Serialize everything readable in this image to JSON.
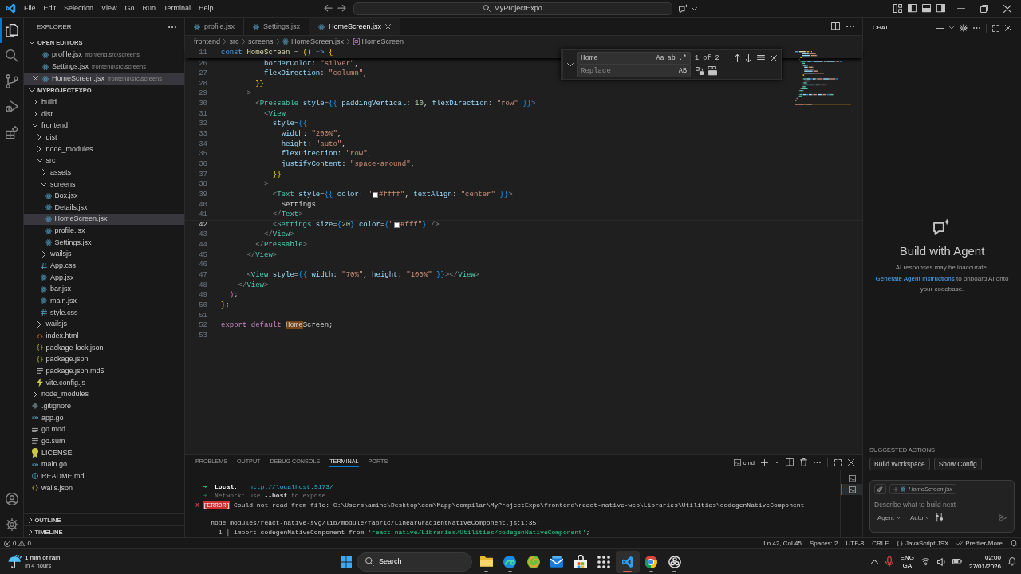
{
  "titlebar": {
    "menus": [
      "File",
      "Edit",
      "Selection",
      "View",
      "Go",
      "Run",
      "Terminal",
      "Help"
    ],
    "search": "MyProjectExpo"
  },
  "activity_bar": {
    "items": [
      {
        "kind": "explorer",
        "selected": true
      },
      {
        "kind": "search",
        "selected": false
      },
      {
        "kind": "source-control",
        "selected": false
      },
      {
        "kind": "run",
        "selected": false
      },
      {
        "kind": "extensions",
        "selected": false
      }
    ],
    "bottom": [
      {
        "kind": "account"
      },
      {
        "kind": "settings"
      }
    ]
  },
  "sidebar": {
    "title": "EXPLORER",
    "open_editors": {
      "title": "OPEN EDITORS",
      "expanded": true,
      "items": [
        {
          "name": "profile.jsx",
          "kind": "react",
          "path": "frontend\\src\\screens",
          "selected": false
        },
        {
          "name": "Settings.jsx",
          "kind": "react",
          "path": "frontend\\src\\screens",
          "selected": false
        },
        {
          "name": "HomeScreen.jsx",
          "kind": "react",
          "path": "frontend\\src\\screens",
          "selected": true
        }
      ]
    },
    "project": {
      "title": "MYPROJECTEXPO",
      "expanded": true,
      "tree": [
        {
          "name": "build",
          "kind": "folder",
          "expanded": false,
          "selected": false
        },
        {
          "name": "dist",
          "kind": "folder",
          "expanded": false,
          "selected": false
        },
        {
          "name": "frontend",
          "kind": "folder",
          "expanded": true,
          "selected": false,
          "children": [
            {
              "name": "dist",
              "kind": "folder",
              "expanded": false,
              "selected": false
            },
            {
              "name": "node_modules",
              "kind": "folder",
              "expanded": false,
              "selected": false
            },
            {
              "name": "src",
              "kind": "folder",
              "expanded": true,
              "selected": false,
              "children": [
                {
                  "name": "assets",
                  "kind": "folder",
                  "expanded": false,
                  "selected": false
                },
                {
                  "name": "screens",
                  "kind": "folder",
                  "expanded": true,
                  "selected": false,
                  "children": [
                    {
                      "name": "Box.jsx",
                      "kind": "react",
                      "selected": false
                    },
                    {
                      "name": "Details.jsx",
                      "kind": "react",
                      "selected": false
                    },
                    {
                      "name": "HomeScreen.jsx",
                      "kind": "react",
                      "selected": true
                    },
                    {
                      "name": "profile.jsx",
                      "kind": "react",
                      "selected": false
                    },
                    {
                      "name": "Settings.jsx",
                      "kind": "react",
                      "selected": false
                    }
                  ]
                },
                {
                  "name": "wailsjs",
                  "kind": "folder",
                  "expanded": false,
                  "selected": false
                },
                {
                  "name": "App.css",
                  "kind": "css",
                  "selected": false
                },
                {
                  "name": "App.jsx",
                  "kind": "react",
                  "selected": false
                },
                {
                  "name": "bar.jsx",
                  "kind": "react",
                  "selected": false
                },
                {
                  "name": "main.jsx",
                  "kind": "react",
                  "selected": false
                },
                {
                  "name": "style.css",
                  "kind": "css",
                  "selected": false
                }
              ]
            },
            {
              "name": "wailsjs",
              "kind": "folder",
              "expanded": false,
              "selected": false
            },
            {
              "name": "index.html",
              "kind": "html",
              "selected": false
            },
            {
              "name": "package-lock.json",
              "kind": "json",
              "selected": false
            },
            {
              "name": "package.json",
              "kind": "json",
              "selected": false
            },
            {
              "name": "package.json.md5",
              "kind": "text",
              "selected": false
            },
            {
              "name": "vite.config.js",
              "kind": "vite",
              "selected": false
            }
          ]
        },
        {
          "name": "node_modules",
          "kind": "folder",
          "expanded": false,
          "selected": false
        },
        {
          "name": ".gitignore",
          "kind": "git",
          "selected": false
        },
        {
          "name": "app.go",
          "kind": "go",
          "selected": false
        },
        {
          "name": "go.mod",
          "kind": "text",
          "selected": false
        },
        {
          "name": "go.sum",
          "kind": "text",
          "selected": false
        },
        {
          "name": "LICENSE",
          "kind": "license",
          "selected": false
        },
        {
          "name": "main.go",
          "kind": "go",
          "selected": false
        },
        {
          "name": "README.md",
          "kind": "info",
          "selected": false
        },
        {
          "name": "wails.json",
          "kind": "json",
          "selected": false
        }
      ]
    },
    "sections": [
      {
        "title": "OUTLINE",
        "expanded": false
      },
      {
        "title": "TIMELINE",
        "expanded": false
      }
    ]
  },
  "editor": {
    "tabs": [
      {
        "label": "profile.jsx",
        "kind": "react",
        "selected": false
      },
      {
        "label": "Settings.jsx",
        "kind": "react",
        "selected": false
      },
      {
        "label": "HomeScreen.jsx",
        "kind": "react",
        "selected": true
      }
    ],
    "breadcrumbs": [
      {
        "label": "frontend",
        "kind": "folder"
      },
      {
        "label": "src",
        "kind": "folder"
      },
      {
        "label": "screens",
        "kind": "folder"
      },
      {
        "label": "HomeScreen.jsx",
        "kind": "react"
      },
      {
        "label": "HomeScreen",
        "kind": "symbol"
      }
    ],
    "sticky": {
      "number": "11",
      "tokens": [
        {
          "kind": "keyword",
          "text": "const "
        },
        {
          "kind": "function",
          "text": "HomeScreen"
        },
        {
          "kind": "plain",
          "text": " = "
        },
        {
          "kind": "brace1",
          "text": "()"
        },
        {
          "kind": "keyword",
          "text": " => "
        },
        {
          "kind": "brace1",
          "text": "{"
        }
      ]
    },
    "lines": [
      {
        "number": "26",
        "current": false,
        "tokens": [
          {
            "kind": "attr",
            "text": "          borderColor"
          },
          {
            "kind": "plain",
            "text": ": "
          },
          {
            "kind": "string",
            "text": "\"silver\""
          },
          {
            "kind": "plain",
            "text": ","
          }
        ]
      },
      {
        "number": "27",
        "current": false,
        "tokens": [
          {
            "kind": "attr",
            "text": "          flexDirection"
          },
          {
            "kind": "plain",
            "text": ": "
          },
          {
            "kind": "string",
            "text": "\"column\""
          },
          {
            "kind": "plain",
            "text": ","
          }
        ]
      },
      {
        "number": "28",
        "current": false,
        "tokens": [
          {
            "kind": "brace1",
            "text": "        }}"
          }
        ]
      },
      {
        "number": "29",
        "current": false,
        "tokens": [
          {
            "kind": "punct",
            "text": "      >"
          }
        ]
      },
      {
        "number": "30",
        "current": false,
        "tokens": [
          {
            "kind": "punct",
            "text": "        <"
          },
          {
            "kind": "tag",
            "text": "Pressable"
          },
          {
            "kind": "attr",
            "text": " style"
          },
          {
            "kind": "plain",
            "text": "="
          },
          {
            "kind": "brace3",
            "text": "{{"
          },
          {
            "kind": "attr",
            "text": " paddingVertical"
          },
          {
            "kind": "plain",
            "text": ": "
          },
          {
            "kind": "number",
            "text": "10"
          },
          {
            "kind": "plain",
            "text": ", "
          },
          {
            "kind": "attr",
            "text": "flexDirection"
          },
          {
            "kind": "plain",
            "text": ": "
          },
          {
            "kind": "string",
            "text": "\"row\""
          },
          {
            "kind": "brace3",
            "text": " }}"
          },
          {
            "kind": "punct",
            "text": ">"
          }
        ]
      },
      {
        "number": "31",
        "current": false,
        "tokens": [
          {
            "kind": "punct",
            "text": "          <"
          },
          {
            "kind": "tag",
            "text": "View"
          }
        ]
      },
      {
        "number": "32",
        "current": false,
        "tokens": [
          {
            "kind": "attr",
            "text": "            style"
          },
          {
            "kind": "plain",
            "text": "="
          },
          {
            "kind": "brace3",
            "text": "{{"
          }
        ]
      },
      {
        "number": "33",
        "current": false,
        "tokens": [
          {
            "kind": "attr",
            "text": "              width"
          },
          {
            "kind": "plain",
            "text": ": "
          },
          {
            "kind": "string",
            "text": "\"200%\""
          },
          {
            "kind": "plain",
            "text": ","
          }
        ]
      },
      {
        "number": "34",
        "current": false,
        "tokens": [
          {
            "kind": "attr",
            "text": "              height"
          },
          {
            "kind": "plain",
            "text": ": "
          },
          {
            "kind": "string",
            "text": "\"auto\""
          },
          {
            "kind": "plain",
            "text": ","
          }
        ]
      },
      {
        "number": "35",
        "current": false,
        "tokens": [
          {
            "kind": "attr",
            "text": "              flexDirection"
          },
          {
            "kind": "plain",
            "text": ": "
          },
          {
            "kind": "string",
            "text": "\"row\""
          },
          {
            "kind": "plain",
            "text": ","
          }
        ]
      },
      {
        "number": "36",
        "current": false,
        "tokens": [
          {
            "kind": "attr",
            "text": "              justifyContent"
          },
          {
            "kind": "plain",
            "text": ": "
          },
          {
            "kind": "string",
            "text": "\"space-around\""
          },
          {
            "kind": "plain",
            "text": ","
          }
        ]
      },
      {
        "number": "37",
        "current": false,
        "tokens": [
          {
            "kind": "brace1",
            "text": "            }}"
          }
        ]
      },
      {
        "number": "38",
        "current": false,
        "tokens": [
          {
            "kind": "punct",
            "text": "          >"
          }
        ]
      },
      {
        "number": "39",
        "current": false,
        "tokens": [
          {
            "kind": "punct",
            "text": "            <"
          },
          {
            "kind": "tag",
            "text": "Text"
          },
          {
            "kind": "attr",
            "text": " style"
          },
          {
            "kind": "plain",
            "text": "="
          },
          {
            "kind": "brace3",
            "text": "{{"
          },
          {
            "kind": "attr",
            "text": " color"
          },
          {
            "kind": "plain",
            "text": ": "
          },
          {
            "kind": "string",
            "text": "\""
          },
          {
            "kind": "swatch",
            "color": "#ffffff"
          },
          {
            "kind": "string",
            "text": "#ffff\""
          },
          {
            "kind": "plain",
            "text": ", "
          },
          {
            "kind": "attr",
            "text": "textAlign"
          },
          {
            "kind": "plain",
            "text": ": "
          },
          {
            "kind": "string",
            "text": "\"center\""
          },
          {
            "kind": "brace3",
            "text": " }}"
          },
          {
            "kind": "punct",
            "text": ">"
          }
        ]
      },
      {
        "number": "40",
        "current": false,
        "tokens": [
          {
            "kind": "plain",
            "text": "              Settings"
          }
        ]
      },
      {
        "number": "41",
        "current": false,
        "tokens": [
          {
            "kind": "punct",
            "text": "            </"
          },
          {
            "kind": "tag",
            "text": "Text"
          },
          {
            "kind": "punct",
            "text": ">"
          }
        ]
      },
      {
        "number": "42",
        "current": true,
        "tokens": [
          {
            "kind": "punct",
            "text": "            <"
          },
          {
            "kind": "tag",
            "text": "Settings"
          },
          {
            "kind": "attr",
            "text": " size"
          },
          {
            "kind": "plain",
            "text": "="
          },
          {
            "kind": "brace3",
            "text": "{"
          },
          {
            "kind": "number",
            "text": "20"
          },
          {
            "kind": "brace3",
            "text": "}"
          },
          {
            "kind": "attr",
            "text": " color"
          },
          {
            "kind": "plain",
            "text": "="
          },
          {
            "kind": "brace3",
            "text": "{"
          },
          {
            "kind": "string",
            "text": "\""
          },
          {
            "kind": "swatch",
            "color": "#ffffff"
          },
          {
            "kind": "string",
            "text": "#fff\""
          },
          {
            "kind": "brace3",
            "text": "}"
          },
          {
            "kind": "punct",
            "text": " />"
          }
        ]
      },
      {
        "number": "43",
        "current": false,
        "tokens": [
          {
            "kind": "punct",
            "text": "          </"
          },
          {
            "kind": "tag",
            "text": "View"
          },
          {
            "kind": "punct",
            "text": ">"
          }
        ]
      },
      {
        "number": "44",
        "current": false,
        "tokens": [
          {
            "kind": "punct",
            "text": "        </"
          },
          {
            "kind": "tag",
            "text": "Pressable"
          },
          {
            "kind": "punct",
            "text": ">"
          }
        ]
      },
      {
        "number": "45",
        "current": false,
        "tokens": [
          {
            "kind": "punct",
            "text": "      </"
          },
          {
            "kind": "tag",
            "text": "View"
          },
          {
            "kind": "punct",
            "text": ">"
          }
        ]
      },
      {
        "number": "46",
        "current": false
      },
      {
        "number": "47",
        "current": false,
        "tokens": [
          {
            "kind": "punct",
            "text": "      <"
          },
          {
            "kind": "tag",
            "text": "View"
          },
          {
            "kind": "attr",
            "text": " style"
          },
          {
            "kind": "plain",
            "text": "="
          },
          {
            "kind": "brace3",
            "text": "{{"
          },
          {
            "kind": "attr",
            "text": " width"
          },
          {
            "kind": "plain",
            "text": ": "
          },
          {
            "kind": "string",
            "text": "\"70%\""
          },
          {
            "kind": "plain",
            "text": ", "
          },
          {
            "kind": "attr",
            "text": "height"
          },
          {
            "kind": "plain",
            "text": ": "
          },
          {
            "kind": "string",
            "text": "\"100%\""
          },
          {
            "kind": "brace3",
            "text": " }}"
          },
          {
            "kind": "punct",
            "text": "></"
          },
          {
            "kind": "tag",
            "text": "View"
          },
          {
            "kind": "punct",
            "text": ">"
          }
        ]
      },
      {
        "number": "48",
        "current": false,
        "tokens": [
          {
            "kind": "punct",
            "text": "    </"
          },
          {
            "kind": "tag",
            "text": "View"
          },
          {
            "kind": "punct",
            "text": ">"
          }
        ]
      },
      {
        "number": "49",
        "current": false,
        "tokens": [
          {
            "kind": "brace2",
            "text": "  )"
          },
          {
            "kind": "plain",
            "text": ";"
          }
        ]
      },
      {
        "number": "50",
        "current": false,
        "tokens": [
          {
            "kind": "brace1",
            "text": "}"
          },
          {
            "kind": "plain",
            "text": ";"
          }
        ]
      },
      {
        "number": "51",
        "current": false
      },
      {
        "number": "52",
        "current": false,
        "tokens": [
          {
            "kind": "control",
            "text": "export default "
          },
          {
            "kind": "match",
            "text": "Home"
          },
          {
            "kind": "plain",
            "text": "Screen;"
          }
        ]
      },
      {
        "number": "53",
        "current": false
      }
    ],
    "find": {
      "value": "Home",
      "toggles": [
        "Aa",
        "ab",
        ".*"
      ],
      "count": "1 of 2",
      "replace_placeholder": "Replace",
      "replace_toggles": [
        "AB"
      ]
    }
  },
  "panel": {
    "tabs": [
      {
        "label": "PROBLEMS",
        "selected": false
      },
      {
        "label": "OUTPUT",
        "selected": false
      },
      {
        "label": "DEBUG CONSOLE",
        "selected": false
      },
      {
        "label": "TERMINAL",
        "selected": true
      },
      {
        "label": "PORTS",
        "selected": false
      }
    ],
    "shell": "cmd",
    "lines": [
      {
        "kind": "text",
        "tokens": [
          {
            "kind": "arrow",
            "text": "  ➜"
          },
          {
            "kind": "label",
            "text": "  Local:"
          },
          {
            "kind": "link",
            "text": "   http://localhost:5173/"
          }
        ]
      },
      {
        "kind": "text",
        "tokens": [
          {
            "kind": "arrowdim",
            "text": "  ➜"
          },
          {
            "kind": "dim",
            "text": "  Network: use "
          },
          {
            "kind": "bold",
            "text": "--host"
          },
          {
            "kind": "dim",
            "text": " to expose"
          }
        ]
      },
      {
        "kind": "text",
        "tokens": [
          {
            "kind": "mark",
            "text": "X"
          },
          {
            "kind": "badge",
            "text": " [ERROR]"
          },
          {
            "kind": "plain",
            "text": " Could not read from file: C:\\Users\\amine\\Desktop\\com\\Mapp\\compilar\\MyProjectExpo\\frontend\\react-native-web\\Libraries\\Utilities\\codegenNativeComponent"
          }
        ]
      },
      {
        "kind": "blank"
      },
      {
        "kind": "text",
        "tokens": [
          {
            "kind": "plain",
            "text": "    node_modules/react-native-svg/lib/module/fabric/LinearGradientNativeComponent.js:1:35:"
          }
        ]
      },
      {
        "kind": "text",
        "tokens": [
          {
            "kind": "plain",
            "text": "      1 │ import codegenNativeComponent from "
          },
          {
            "kind": "string",
            "text": "'react-native/Libraries/Utilities/codegenNativeComponent'"
          },
          {
            "kind": "plain",
            "text": ";"
          }
        ]
      }
    ],
    "instances": [
      {
        "selected": false
      },
      {
        "selected": true
      }
    ]
  },
  "chat": {
    "title": "CHAT",
    "heading": "Build with Agent",
    "note": "AI responses may be inaccurate.",
    "link": "Generate Agent Instructions",
    "link_rest": "to onboard AI onto your codebase.",
    "suggested_title": "SUGGESTED ACTIONS",
    "suggestions": [
      "Build Workspace",
      "Show Config"
    ],
    "context_file": "HomeScreen.jsx",
    "placeholder": "Describe what to build next",
    "mode": "Agent",
    "model": "Auto"
  },
  "status_bar": {
    "errors": "0",
    "warnings": "0",
    "items": [
      {
        "kind": "text",
        "text": "Ln 42, Col 45"
      },
      {
        "kind": "text",
        "text": "Spaces: 2"
      },
      {
        "kind": "text",
        "text": "UTF-8"
      },
      {
        "kind": "text",
        "text": "CRLF"
      },
      {
        "kind": "language",
        "text": "JavaScript JSX"
      },
      {
        "kind": "formatter",
        "text": "Prettier-More"
      },
      {
        "kind": "bell"
      }
    ]
  },
  "taskbar": {
    "weather": {
      "title": "1 mm of rain",
      "subtitle": "In 4 hours"
    },
    "search": "Search",
    "apps": [
      {
        "kind": "files",
        "selected": false,
        "running": true
      },
      {
        "kind": "browser",
        "selected": false,
        "running": true
      },
      {
        "kind": "swirl",
        "selected": false,
        "running": false
      },
      {
        "kind": "mail",
        "selected": false,
        "running": false
      },
      {
        "kind": "store",
        "selected": false,
        "running": false
      },
      {
        "kind": "apps",
        "selected": false,
        "running": false
      },
      {
        "kind": "editor",
        "selected": true,
        "running": true
      },
      {
        "kind": "browser-circle",
        "selected": false,
        "running": true
      },
      {
        "kind": "ring",
        "selected": false,
        "running": true
      }
    ],
    "input_language": {
      "language": "ENG",
      "region": "GA"
    },
    "clock": {
      "time": "02:00",
      "date": "27/01/2026"
    }
  }
}
